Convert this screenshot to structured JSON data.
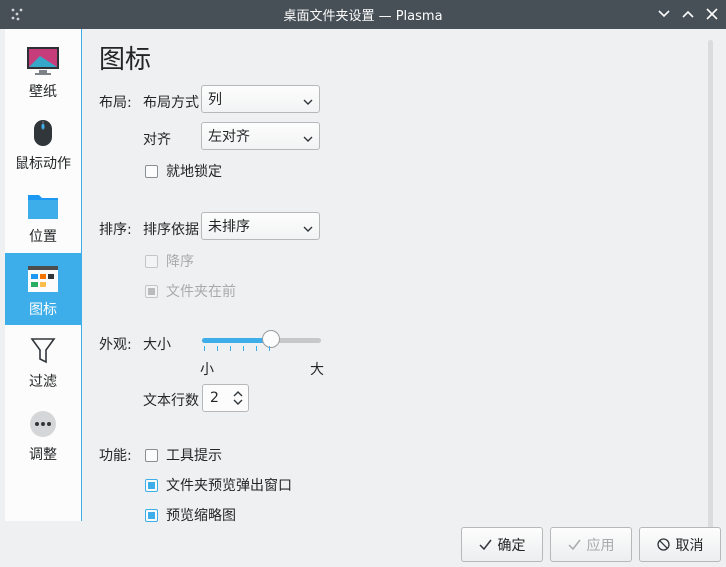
{
  "window": {
    "title": "桌面文件夹设置 — Plasma"
  },
  "sidebar": {
    "items": [
      {
        "label": "壁纸",
        "icon": "monitor-wallpaper-icon"
      },
      {
        "label": "鼠标动作",
        "icon": "mouse-icon"
      },
      {
        "label": "位置",
        "icon": "folder-icon"
      },
      {
        "label": "图标",
        "icon": "icons-view-icon",
        "active": true
      },
      {
        "label": "过滤",
        "icon": "filter-icon"
      },
      {
        "label": "调整",
        "icon": "more-icon"
      }
    ]
  },
  "page": {
    "title": "图标"
  },
  "layout": {
    "section_label": "布局:",
    "arrangement_label": "布局方式",
    "arrangement_value": "列",
    "align_label": "对齐",
    "align_value": "左对齐",
    "lock_label": "就地锁定",
    "lock_checked": false
  },
  "sorting": {
    "section_label": "排序:",
    "sort_by_label": "排序依据",
    "sort_by_value": "未排序",
    "descending_label": "降序",
    "descending_checked": false,
    "folders_first_label": "文件夹在前",
    "folders_first_checked": true
  },
  "appearance": {
    "section_label": "外观:",
    "size_label": "大小",
    "size_min_label": "小",
    "size_max_label": "大",
    "size_level": 0.58,
    "text_lines_label": "文本行数",
    "text_lines_value": "2"
  },
  "features": {
    "section_label": "功能:",
    "tooltips_label": "工具提示",
    "tooltips_checked": false,
    "folder_preview_label": "文件夹预览弹出窗口",
    "folder_preview_checked": true,
    "thumbnails_label": "预览缩略图",
    "thumbnails_checked": true
  },
  "buttons": {
    "ok_label": "确定",
    "apply_label": "应用",
    "cancel_label": "取消"
  },
  "colors": {
    "accent": "#3daee9",
    "titlebar": "#475057",
    "window_bg": "#eff0f1"
  }
}
